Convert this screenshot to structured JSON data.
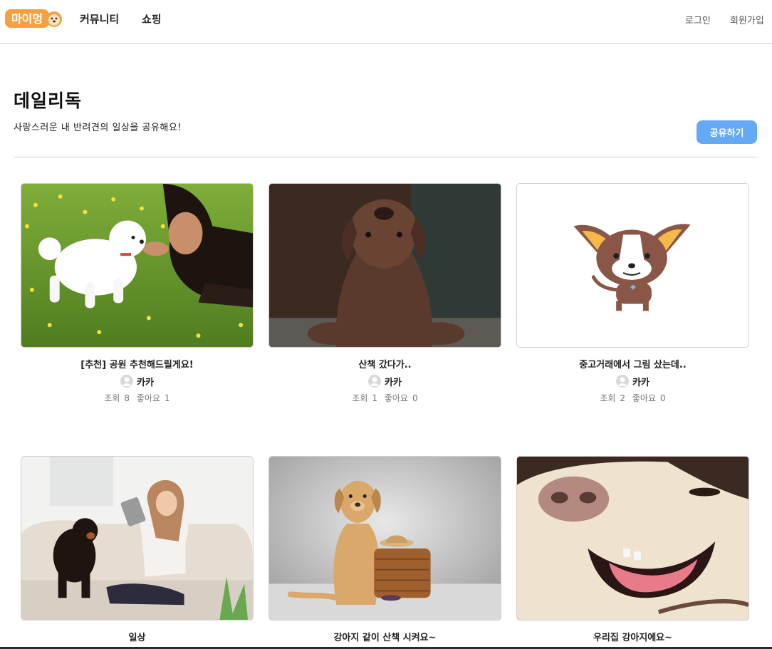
{
  "header": {
    "logo_text": "마이멍",
    "nav": [
      "커뮤니티",
      "쇼핑"
    ],
    "login": "로그인",
    "signup": "회원가입"
  },
  "page": {
    "title": "데일리독",
    "subtitle": "사랑스러운 내 반려견의 일상을 공유해요!",
    "share_label": "공유하기"
  },
  "labels": {
    "views": "조회",
    "likes": "좋아요"
  },
  "posts": [
    {
      "title": "[추천] 공원 추천해드릴게요!",
      "author": "카카",
      "views": 8,
      "likes": 1,
      "image": "white-dog-with-girl-in-grass"
    },
    {
      "title": "산책 갔다가..",
      "author": "카카",
      "views": 1,
      "likes": 0,
      "image": "brown-labrador-dark-room"
    },
    {
      "title": "중고거래에서 그림 샀는데..",
      "author": "카카",
      "views": 2,
      "likes": 0,
      "image": "cartoon-chihuahua-illustration"
    },
    {
      "title": "일상",
      "author": "",
      "views": null,
      "likes": null,
      "image": "girl-with-tablet-and-spaniel-on-sofa"
    },
    {
      "title": "강아지 같이 산책 시켜요~",
      "author": "",
      "views": null,
      "likes": null,
      "image": "golden-retriever-with-suitcase"
    },
    {
      "title": "우리집 강아지에요~",
      "author": "",
      "views": null,
      "likes": null,
      "image": "dog-closeup-smiling"
    }
  ],
  "colors": {
    "accent": "#63a9f5",
    "logo": "#f5a142"
  }
}
